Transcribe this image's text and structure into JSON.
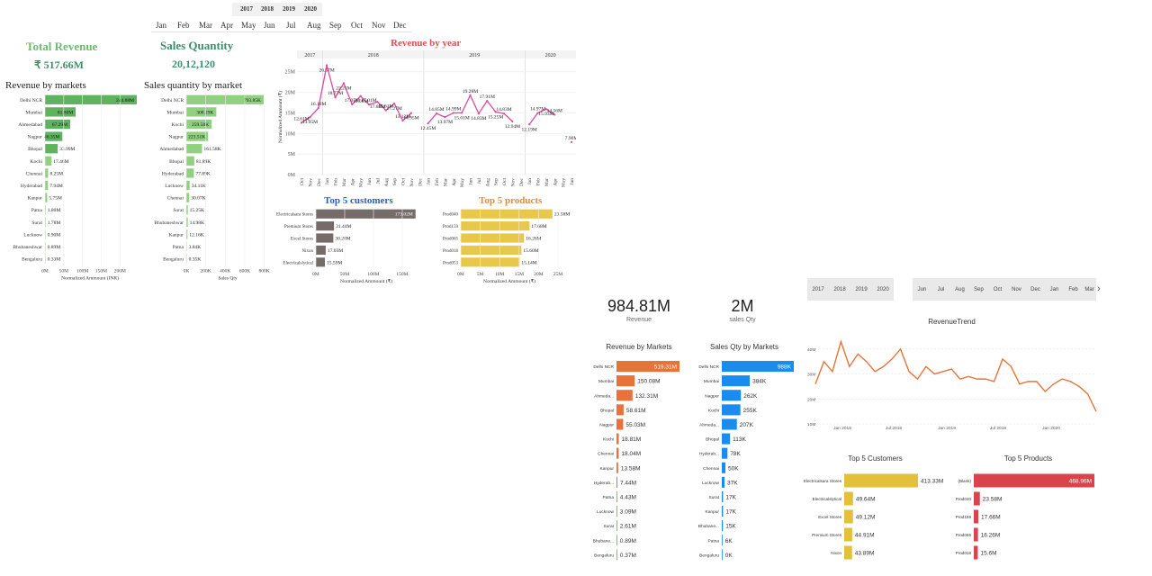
{
  "left_dashboard": {
    "year_slicer": [
      "2017",
      "2018",
      "2019",
      "2020"
    ],
    "month_slicer": [
      "Jan",
      "Feb",
      "Mar",
      "Apr",
      "May",
      "Jun",
      "Jul",
      "Aug",
      "Sep",
      "Oct",
      "Nov",
      "Dec"
    ],
    "kpis": {
      "total_revenue_label": "Total Revenue",
      "total_revenue_value": "₹ 517.66M",
      "sales_qty_label": "Sales Quantity",
      "sales_qty_value": "20,12,120"
    },
    "revenue_by_markets": {
      "title": "Revenue by markets",
      "xlabel": "Normalized Ammount (INR)",
      "ticks": [
        "0M",
        "50M",
        "100M",
        "150M",
        "200M"
      ]
    },
    "sales_qty_by_market": {
      "title": "Sales quantity by market",
      "xlabel": "Sales Qty",
      "ticks": [
        "0K",
        "200K",
        "400K",
        "600K",
        "800K"
      ]
    },
    "revenue_by_year": {
      "title": "Revenue by year",
      "ylabel": "Normalized Ammount (₹)",
      "yticks": [
        "0M",
        "5M",
        "10M",
        "15M",
        "20M",
        "25M"
      ],
      "years": [
        "2017",
        "2018",
        "2019",
        "2020"
      ]
    },
    "top5_customers": {
      "title": "Top 5 customers",
      "xlabel": "Normalized Ammount (₹)",
      "ticks": [
        "0M",
        "50M",
        "100M",
        "150M"
      ]
    },
    "top5_products": {
      "title": "Top 5 products",
      "xlabel": "Normalized Ammount (₹)",
      "ticks": [
        "0M",
        "5M",
        "10M",
        "15M",
        "20M",
        "25M"
      ]
    }
  },
  "right_dashboard": {
    "year_slicer": [
      "2017",
      "2018",
      "2019",
      "2020"
    ],
    "month_slicer": [
      "Jun",
      "Jul",
      "Aug",
      "Sep",
      "Oct",
      "Nov",
      "Dec",
      "Jan",
      "Feb",
      "Mar"
    ],
    "next_icon": "chevron-right-icon",
    "kpis": {
      "revenue_value": "984.81M",
      "revenue_label": "Revenue",
      "qty_value": "2M",
      "qty_label": "sales Qty"
    },
    "revenue_by_markets_title": "Revenue by Markets",
    "sales_qty_by_markets_title": "Sales Qty by Markets",
    "revenue_trend": {
      "title": "RevenueTrend",
      "yticks": [
        "10M",
        "20M",
        "30M",
        "40M"
      ],
      "xticks": [
        "Jan 2018",
        "Jul 2018",
        "Jan 2019",
        "Jul 2019",
        "Jan 2020"
      ]
    },
    "top5_customers_title": "Top 5 Customers",
    "top5_products_title": "Top 5 Products"
  },
  "colors": {
    "green_dark": "#5fb35f",
    "green_light": "#8fd17f",
    "pink_line": "#e0489a",
    "customer_bar": "#756c69",
    "product_bar": "#e8c84a",
    "pbi_orange": "#e8733a",
    "pbi_blue": "#1a8cf0",
    "pbi_yellow": "#e3c03a",
    "pbi_red": "#d9434c",
    "title_red": "#d9534f",
    "title_blue": "#1f5fd6",
    "title_orange": "#ec8a2e"
  },
  "chart_data": [
    {
      "type": "bar",
      "orientation": "horizontal",
      "title": "Revenue by markets",
      "xlabel": "Normalized Ammount (INR)",
      "xlim": [
        0,
        240
      ],
      "categories": [
        "Delhi NCR",
        "Mumbai",
        "Ahmedabad",
        "Nagpur",
        "Bhopal",
        "Kochi",
        "Chennai",
        "Hyderabad",
        "Kanpur",
        "Patna",
        "Surat",
        "Lucknow",
        "Bhubaneshwar",
        "Bengaluru"
      ],
      "values": [
        244.88,
        81.8,
        67.29,
        46.35,
        33.99,
        17.46,
        8.25,
        7.94,
        5.75,
        1.8,
        1.78,
        0.9,
        0.89,
        0.33
      ],
      "labels": [
        "244.88M",
        "81.80M",
        "67.29M",
        "46.35M",
        "33.99M",
        "17.46M",
        "8.25M",
        "7.94M",
        "5.75M",
        "1.80M",
        "1.78M",
        "0.90M",
        "0.89M",
        "0.33M"
      ]
    },
    {
      "type": "bar",
      "orientation": "horizontal",
      "title": "Sales quantity by market",
      "xlabel": "Sales Qty",
      "xlim": [
        0,
        850
      ],
      "categories": [
        "Delhi NCR",
        "Mumbai",
        "Kochi",
        "Nagpur",
        "Ahmedabad",
        "Bhopal",
        "Hyderabad",
        "Lucknow",
        "Chennai",
        "Surat",
        "Bhubaneshwar",
        "Kanpur",
        "Patna",
        "Bengaluru"
      ],
      "values": [
        793.85,
        308.29,
        259.58,
        223.51,
        161.58,
        81.89,
        77.89,
        34.11,
        30.07,
        15.25,
        14.98,
        12.16,
        3.84,
        0.35
      ],
      "labels": [
        "793.85K",
        "308.29K",
        "259.58K",
        "223.51K",
        "161.58K",
        "81.89K",
        "77.89K",
        "34.11K",
        "30.07K",
        "15.25K",
        "14.98K",
        "12.16K",
        "3.84K",
        "0.35K"
      ]
    },
    {
      "type": "line",
      "title": "Revenue by year",
      "ylabel": "Normalized Ammount (₹)",
      "ylim": [
        0,
        28
      ],
      "x": [
        "Oct",
        "Nov",
        "Dec",
        "Jan",
        "Feb",
        "Mar",
        "Apr",
        "May",
        "Jun",
        "Jul",
        "Aug",
        "Sep",
        "Oct",
        "Nov",
        "Dec",
        "Jan",
        "Feb",
        "Mar",
        "Apr",
        "May",
        "Jun",
        "Jul",
        "Aug",
        "Sep",
        "Oct",
        "Nov",
        "Dec",
        "Jan",
        "Feb",
        "Mar",
        "Apr",
        "May",
        "Jun"
      ],
      "series": [
        {
          "values": [
            12.61,
            13.95,
            16.18,
            26.57,
            18.77,
            22.21,
            17.07,
            19.08,
            17.01,
            17.68,
            15.61,
            17.27,
            13.12,
            14.95,
            null,
            12.45,
            14.85,
            13.97,
            14.99,
            15.01,
            19.28,
            14.83,
            17.91,
            15.25,
            14.83,
            12.94,
            null,
            12.19,
            14.97,
            15.93,
            14.56,
            null,
            7.9
          ],
          "labels": [
            "12.61M",
            "13.95M",
            "16.18M",
            "26.57M",
            "18.77M",
            "22.21M",
            "17.07M",
            "19.08M",
            "17.01M",
            "17.68M",
            "15.61M",
            "17.27M",
            "13.12M",
            "14.95M",
            "",
            "12.45M",
            "14.85M",
            "13.97M",
            "14.99M",
            "15.01M",
            "19.28M",
            "14.83M",
            "17.91M",
            "15.25M",
            "14.83M",
            "12.94M",
            "",
            "12.19M",
            "14.97M",
            "15.93M",
            "14.56M",
            "",
            "7.90M"
          ]
        }
      ]
    },
    {
      "type": "bar",
      "orientation": "horizontal",
      "title": "Top 5 customers",
      "xlabel": "Normalized Ammount (₹)",
      "xlim": [
        0,
        175
      ],
      "categories": [
        "Electricalsara Stores",
        "Premium Stores",
        "Excel Stores",
        "Nixon",
        "Electricalslytical"
      ],
      "values": [
        173.02,
        31.44,
        30.28,
        17.03,
        15.59
      ],
      "labels": [
        "173.02M",
        "31.44M",
        "30.28M",
        "17.03M",
        "15.59M"
      ]
    },
    {
      "type": "bar",
      "orientation": "horizontal",
      "title": "Top 5 products",
      "xlabel": "Normalized Ammount (₹)",
      "xlim": [
        0,
        25
      ],
      "categories": [
        "Prod040",
        "Prod159",
        "Prod065",
        "Prod018",
        "Prod053"
      ],
      "values": [
        23.58,
        17.68,
        16.26,
        15.6,
        15.14
      ],
      "labels": [
        "23.58M",
        "17.68M",
        "16.26M",
        "15.60M",
        "15.14M"
      ]
    },
    {
      "type": "bar",
      "orientation": "horizontal",
      "title": "Revenue by Markets",
      "categories": [
        "Delhi NCR",
        "Mumbai",
        "Ahmeda...",
        "Bhopal",
        "Nagpur",
        "Kochi",
        "Chennai",
        "Kanpur",
        "Hyderab...",
        "Patna",
        "Lucknow",
        "Surat",
        "Bhubane...",
        "Bengaluru"
      ],
      "values": [
        519.31,
        150.08,
        132.31,
        58.61,
        55.03,
        18.81,
        18.04,
        13.58,
        7.44,
        4.43,
        3.09,
        2.61,
        0.89,
        0.37
      ],
      "labels": [
        "519.31M",
        "150.08M",
        "132.31M",
        "58.61M",
        "55.03M",
        "18.81M",
        "18.04M",
        "13.58M",
        "7.44M",
        "4.43M",
        "3.09M",
        "2.61M",
        "0.89M",
        "0.37M"
      ]
    },
    {
      "type": "bar",
      "orientation": "horizontal",
      "title": "Sales Qty by Markets",
      "categories": [
        "Delhi NCR",
        "Mumbai",
        "Nagpur",
        "Kochi",
        "Ahmeda...",
        "Bhopal",
        "Hyderab...",
        "Chennai",
        "Lucknow",
        "Surat",
        "Kanpur",
        "Bhubane...",
        "Patna",
        "Bengaluru"
      ],
      "values": [
        988,
        384,
        262,
        255,
        207,
        113,
        78,
        50,
        37,
        17,
        17,
        15,
        6,
        0
      ],
      "labels": [
        "988K",
        "384K",
        "262K",
        "255K",
        "207K",
        "113K",
        "78K",
        "50K",
        "37K",
        "17K",
        "17K",
        "15K",
        "6K",
        "0K"
      ]
    },
    {
      "type": "line",
      "title": "RevenueTrend",
      "ylim": [
        10,
        45
      ],
      "series": [
        {
          "values": [
            26,
            35,
            31,
            43,
            33,
            38,
            35,
            31,
            33,
            36,
            40,
            31,
            28,
            33,
            30,
            31,
            32,
            28,
            29,
            28,
            28,
            27,
            36,
            33,
            26,
            27,
            27,
            23,
            26,
            28,
            27,
            25,
            22,
            15
          ]
        }
      ]
    },
    {
      "type": "bar",
      "orientation": "horizontal",
      "title": "Top 5 Customers",
      "categories": [
        "Electricalsara Stores",
        "Electricalslytical",
        "Excel Stores",
        "Premium Stores",
        "Nixon"
      ],
      "values": [
        413.33,
        49.64,
        49.12,
        44.91,
        43.89
      ],
      "labels": [
        "413.33M",
        "49.64M",
        "49.12M",
        "44.91M",
        "43.89M"
      ]
    },
    {
      "type": "bar",
      "orientation": "horizontal",
      "title": "Top 5 Products",
      "categories": [
        "(Blank)",
        "Prod040",
        "Prod159",
        "Prod065",
        "Prod018"
      ],
      "values": [
        468.96,
        23.58,
        17.66,
        16.26,
        15.6
      ],
      "labels": [
        "468.96M",
        "23.58M",
        "17.66M",
        "16.26M",
        "15.6M"
      ]
    }
  ]
}
